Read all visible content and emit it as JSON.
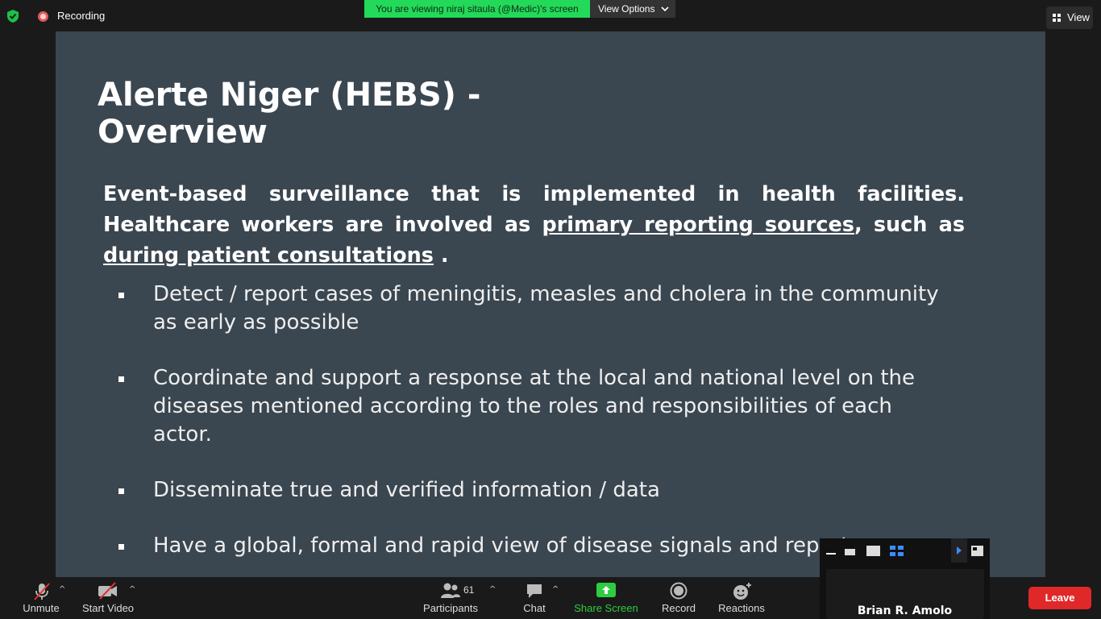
{
  "topbar": {
    "recording_label": "Recording",
    "viewing_banner": "You are viewing niraj sitaula (@Medic)'s screen",
    "view_options_label": "View Options",
    "view_label": "View"
  },
  "slide": {
    "title_line1": "Alerte Niger (HEBS) -",
    "title_line2": "Overview",
    "lead_part1": "Event-based surveillance that is implemented in health facilities. Healthcare workers are involved as ",
    "lead_link1": "primary reporting sources",
    "lead_part2": ", such as ",
    "lead_link2": "during patient consultations",
    "lead_part3": " .",
    "bullets": [
      "Detect / report cases of meningitis, measles and cholera in the community as early as possible",
      "Coordinate and support a response at the local and national level on the diseases mentioned according to the roles and responsibilities of each actor.",
      "Disseminate true and verified information / data",
      "Have a global, formal and rapid view of disease signals and reports."
    ]
  },
  "toolbar": {
    "unmute_label": "Unmute",
    "start_video_label": "Start Video",
    "participants_label": "Participants",
    "participants_count": "61",
    "chat_label": "Chat",
    "share_screen_label": "Share Screen",
    "record_label": "Record",
    "reactions_label": "Reactions",
    "leave_label": "Leave"
  },
  "video_thumbnail": {
    "participant_name": "Brian R. Amolo"
  },
  "colors": {
    "slide_bg": "#3a4650",
    "banner_green": "#23d959",
    "share_green": "#2ecc40",
    "leave_red": "#e02828"
  }
}
